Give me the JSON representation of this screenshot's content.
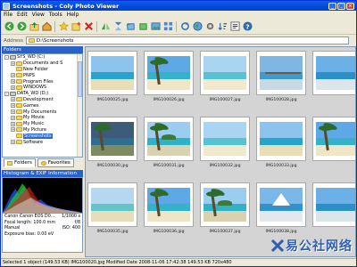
{
  "window": {
    "title": "Screenshots - Coly Photo Viewer"
  },
  "menu": [
    "File",
    "Edit",
    "View",
    "Tools",
    "Help"
  ],
  "toolbar": {
    "buttons": [
      "back-icon",
      "forward-icon",
      "up-folder-icon",
      "home-icon",
      "favorites-star-icon",
      "add-favorite-icon",
      "delete-icon",
      "flip-horizontal-icon",
      "flip-vertical-icon",
      "rotate-left-icon",
      "rotate-right-icon",
      "slideshow-icon",
      "view-mode-icon",
      "refresh-icon",
      "map-icon",
      "settings-icon",
      "sort-icon",
      "info-icon",
      "help-icon"
    ]
  },
  "address": {
    "label": "Address",
    "value": "D:\\Screenshots"
  },
  "folders": {
    "title": "Folders",
    "items": [
      {
        "label": "SYS_WD  (C:)",
        "level": 0,
        "expander": "-"
      },
      {
        "label": "Documents and S",
        "level": 1,
        "expander": "+"
      },
      {
        "label": "New Folder",
        "level": 1,
        "expander": ""
      },
      {
        "label": "PNPS",
        "level": 1,
        "expander": "+"
      },
      {
        "label": "Program Files",
        "level": 1,
        "expander": "+"
      },
      {
        "label": "WINDOWS",
        "level": 1,
        "expander": "+"
      },
      {
        "label": "DATA_WD  (D:)",
        "level": 0,
        "expander": "-"
      },
      {
        "label": "Development",
        "level": 1,
        "expander": "+"
      },
      {
        "label": "Games",
        "level": 1,
        "expander": "+"
      },
      {
        "label": "My Documents",
        "level": 1,
        "expander": "+"
      },
      {
        "label": "My Movie",
        "level": 1,
        "expander": "+"
      },
      {
        "label": "My Music",
        "level": 1,
        "expander": "+"
      },
      {
        "label": "My Picture",
        "level": 1,
        "expander": "+"
      },
      {
        "label": "Screenshots",
        "level": 1,
        "expander": "",
        "selected": true
      },
      {
        "label": "Software",
        "level": 1,
        "expander": "+"
      }
    ]
  },
  "tabs": [
    {
      "label": "Folders",
      "icon": "folder-icon",
      "active": true
    },
    {
      "label": "Favorites",
      "icon": "star-icon",
      "active": false
    }
  ],
  "histogram": {
    "title": "Histogram & EXIF Information",
    "exif": [
      {
        "label": "Canon Canon EOS D0...",
        "value": "1/1000 s"
      },
      {
        "label": "Focal length: 100.0 mm",
        "value": "f/8"
      },
      {
        "label": "Manual",
        "value": "ISO: 400"
      },
      {
        "label": "Exposure bias: 0.00 eV",
        "value": ""
      }
    ]
  },
  "thumbnails": [
    {
      "name": "IMG100025.jpg",
      "scene": "bay"
    },
    {
      "name": "IMG100026.jpg",
      "scene": "palm"
    },
    {
      "name": "IMG100027.jpg",
      "scene": "beach"
    },
    {
      "name": "IMG100028.jpg",
      "scene": "pier"
    },
    {
      "name": "",
      "scene": "sea"
    },
    {
      "name": "IMG100030.jpg",
      "scene": "dark"
    },
    {
      "name": "IMG100031.jpg",
      "scene": "island"
    },
    {
      "name": "IMG100032.jpg",
      "scene": "beach"
    },
    {
      "name": "IMG100033.jpg",
      "scene": "bay"
    },
    {
      "name": "",
      "scene": "palm"
    },
    {
      "name": "IMG100035.jpg",
      "scene": "lagoon"
    },
    {
      "name": "IMG100036.jpg",
      "scene": "palm"
    },
    {
      "name": "IMG100037.jpg",
      "scene": "island"
    },
    {
      "name": "IMG100038.jpg",
      "scene": "sail"
    },
    {
      "name": "",
      "scene": "sea"
    }
  ],
  "watermark": "易公社网络",
  "status": "Selected 1 object (149.53 KB)   IMG100020.jpg  Modified Date  2008-11-06 17:42:38   149.53 KB  720x480",
  "colors": {
    "titlebar": "#0349D8",
    "selection": "#316AC5",
    "panel_header": "#2962C9",
    "thumb_area": "#D4D4D4"
  }
}
